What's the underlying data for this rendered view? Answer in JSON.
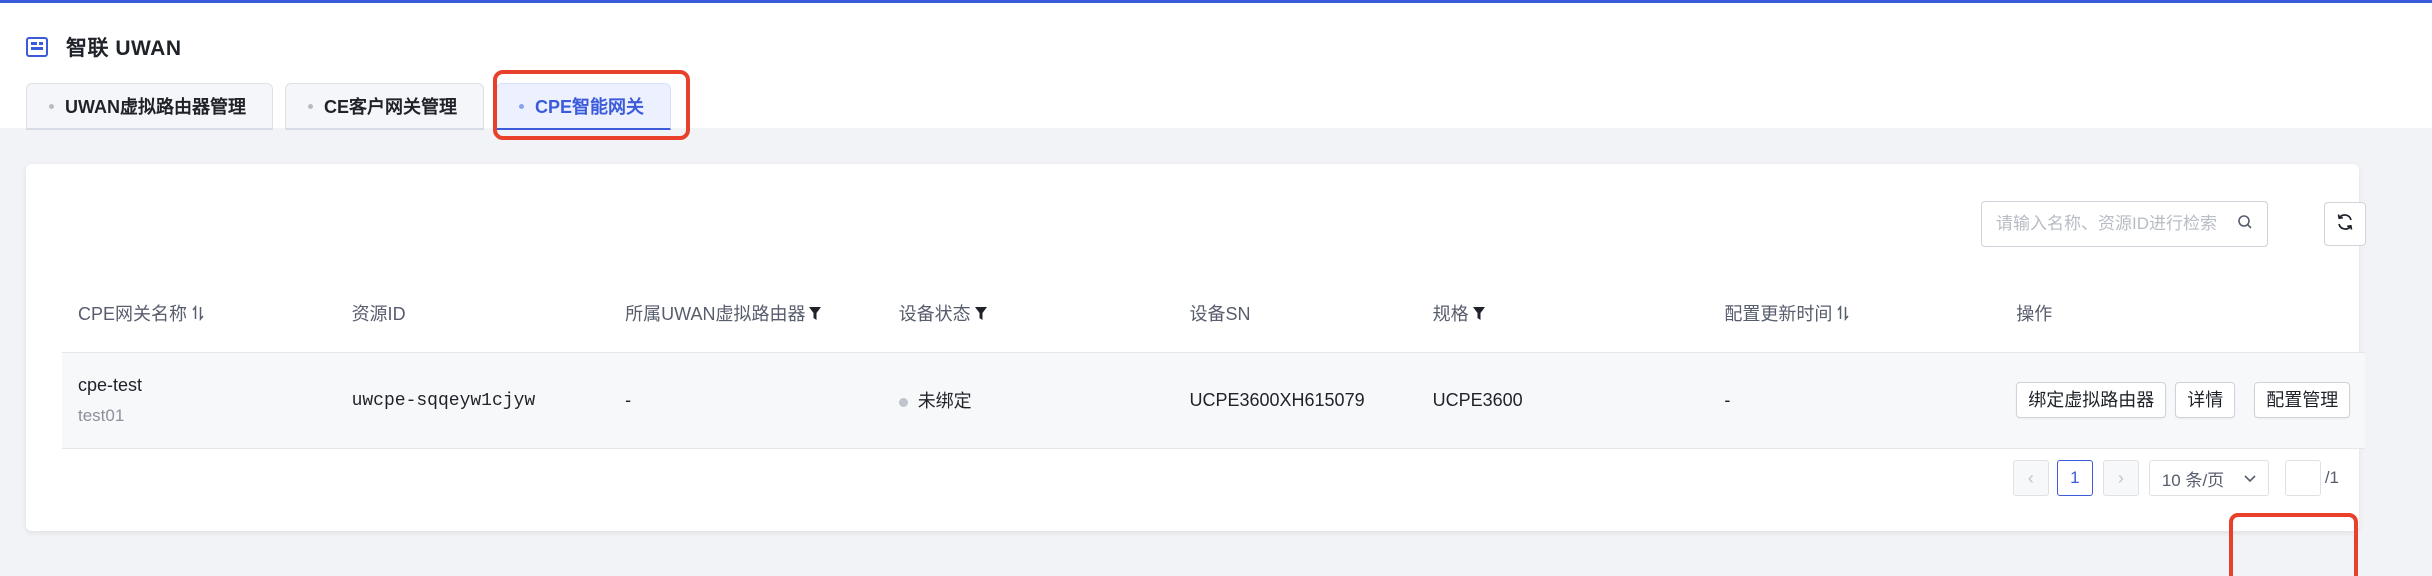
{
  "app": {
    "title": "智联 UWAN"
  },
  "tabs": [
    {
      "label": "UWAN虚拟路由器管理",
      "active": false
    },
    {
      "label": "CE客户网关管理",
      "active": false
    },
    {
      "label": "CPE智能网关",
      "active": true
    }
  ],
  "toolbar": {
    "search_placeholder": "请输入名称、资源ID进行检索",
    "search_value": ""
  },
  "table": {
    "columns": [
      {
        "label": "CPE网关名称",
        "icon": "sort-icon"
      },
      {
        "label": "资源ID",
        "icon": ""
      },
      {
        "label": "所属UWAN虚拟路由器",
        "icon": "filter-icon"
      },
      {
        "label": "设备状态",
        "icon": "filter-icon"
      },
      {
        "label": "设备SN",
        "icon": ""
      },
      {
        "label": "规格",
        "icon": "filter-icon"
      },
      {
        "label": "配置更新时间",
        "icon": "sort-icon"
      },
      {
        "label": "操作",
        "icon": ""
      }
    ],
    "rows": [
      {
        "name": "cpe-test",
        "sub_name": "test01",
        "resource_id": "uwcpe-sqqeyw1cjyw",
        "router": "-",
        "status": "未绑定",
        "sn": "UCPE3600XH615079",
        "spec": "UCPE3600",
        "updated": "-",
        "actions": [
          "绑定虚拟路由器",
          "详情",
          "配置管理"
        ]
      }
    ]
  },
  "pagination": {
    "prev": "‹",
    "current_page": "1",
    "next": "›",
    "page_size": "10 条/页",
    "total_pages": "/1"
  },
  "colors": {
    "accent": "#3b5bdb",
    "highlight": "#e8402a"
  }
}
